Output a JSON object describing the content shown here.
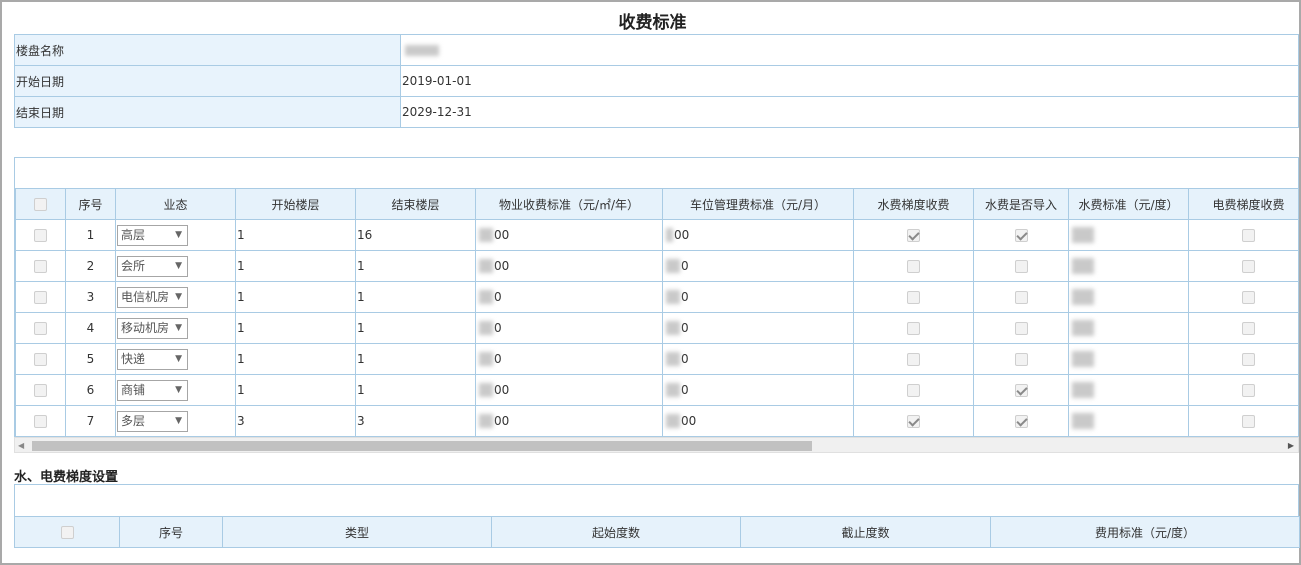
{
  "page": {
    "title": "收费标准"
  },
  "info": {
    "rows": [
      {
        "label": "楼盘名称",
        "value": ""
      },
      {
        "label": "开始日期",
        "value": "2019-01-01"
      },
      {
        "label": "结束日期",
        "value": "2029-12-31"
      }
    ]
  },
  "grid": {
    "headers": {
      "seq": "序号",
      "type": "业态",
      "start_floor": "开始楼层",
      "end_floor": "结束楼层",
      "property_fee": "物业收费标准（元/㎡/年）",
      "parking_fee": "车位管理费标准（元/月）",
      "water_tier": "水费梯度收费",
      "water_import": "水费是否导入",
      "water_std": "水费标准（元/度）",
      "elec_tier": "电费梯度收费"
    },
    "rows": [
      {
        "seq": "1",
        "type": "高层",
        "start": "1",
        "end": "16",
        "property_fee": "00",
        "parking_fee": "00",
        "water_tier": true,
        "water_import": true,
        "elec_tier": false
      },
      {
        "seq": "2",
        "type": "会所",
        "start": "1",
        "end": "1",
        "property_fee": "00",
        "parking_fee": "0",
        "water_tier": false,
        "water_import": false,
        "elec_tier": false
      },
      {
        "seq": "3",
        "type": "电信机房",
        "start": "1",
        "end": "1",
        "property_fee": "0",
        "parking_fee": "0",
        "water_tier": false,
        "water_import": false,
        "elec_tier": false
      },
      {
        "seq": "4",
        "type": "移动机房",
        "start": "1",
        "end": "1",
        "property_fee": "0",
        "parking_fee": "0",
        "water_tier": false,
        "water_import": false,
        "elec_tier": false
      },
      {
        "seq": "5",
        "type": "快递",
        "start": "1",
        "end": "1",
        "property_fee": "0",
        "parking_fee": "0",
        "water_tier": false,
        "water_import": false,
        "elec_tier": false
      },
      {
        "seq": "6",
        "type": "商铺",
        "start": "1",
        "end": "1",
        "property_fee": "00",
        "parking_fee": "0",
        "water_tier": false,
        "water_import": true,
        "elec_tier": false
      },
      {
        "seq": "7",
        "type": "多层",
        "start": "3",
        "end": "3",
        "property_fee": "00",
        "parking_fee": "00",
        "water_tier": true,
        "water_import": true,
        "elec_tier": false
      }
    ]
  },
  "tier_section": {
    "title": "水、电费梯度设置",
    "headers": {
      "seq": "序号",
      "type": "类型",
      "start": "起始度数",
      "end": "截止度数",
      "fee": "费用标准（元/度）"
    }
  },
  "icons": {
    "dropdown": "chevron-down-icon",
    "scroll_left": "arrow-left-icon",
    "scroll_right": "arrow-right-icon"
  },
  "colors": {
    "header_bg": "#e6f2fb",
    "label_bg": "#e8f3fc",
    "border": "#a9cbe4"
  }
}
